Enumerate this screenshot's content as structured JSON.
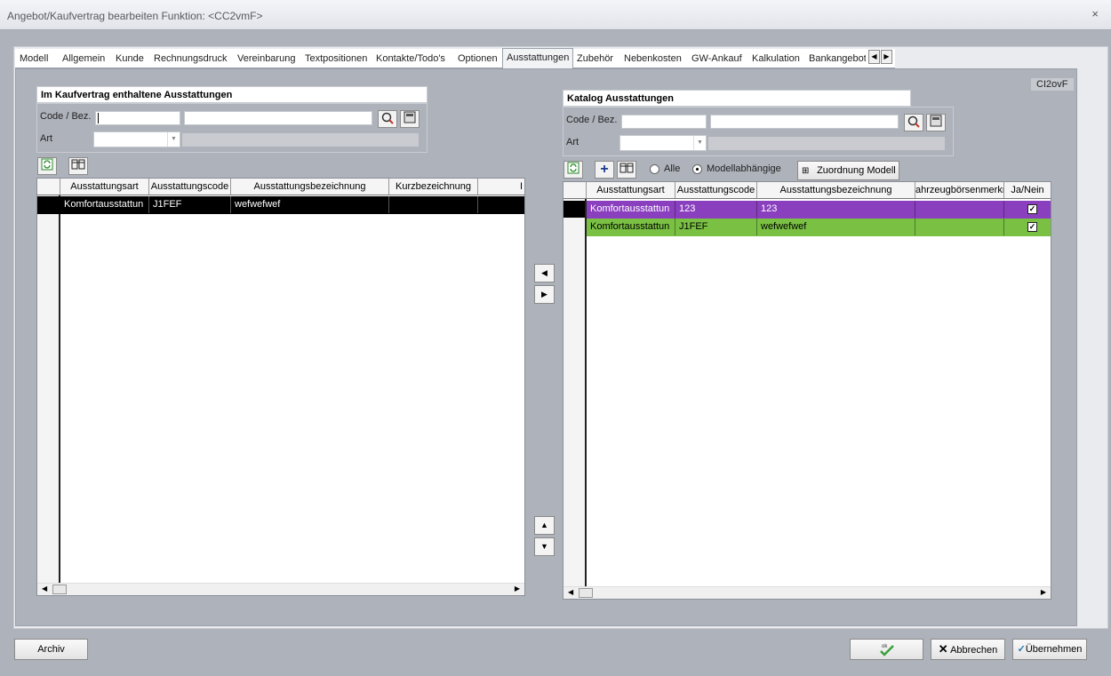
{
  "window": {
    "title": "Angebot/Kaufvertrag bearbeiten    Funktion: <CC2vmF>",
    "close_glyph": "×"
  },
  "tabs": [
    "Modell",
    "Allgemein",
    "Kunde",
    "Rechnungsdruck",
    "Vereinbarung",
    "Textpositionen",
    "Kontakte/Todo's",
    "Optionen",
    "Ausstattungen",
    "Zubehör",
    "Nebenkosten",
    "GW-Ankauf",
    "Kalkulation",
    "Bankangebot"
  ],
  "active_tab": "Ausstattungen",
  "corner_label": "CI2ovF",
  "left_panel": {
    "title": "Im Kaufvertrag enthaltene Ausstattungen",
    "code_label": "Code / Bez.",
    "art_label": "Art",
    "code_value": "",
    "bez_value": "",
    "art_value": "",
    "columns": [
      "Ausstattungsart",
      "Ausstattungscode",
      "Ausstattungsbezeichnung",
      "Kurzbezeichnung",
      "I"
    ],
    "rows": [
      {
        "art": "Komfortausstattun",
        "code": "J1FEF",
        "bez": "wefwefwef",
        "kurz": "",
        "extra": ""
      }
    ]
  },
  "right_panel": {
    "title": "Katalog Ausstattungen",
    "code_label": "Code / Bez.",
    "art_label": "Art",
    "radio_all": "Alle",
    "radio_model": "Modellabhängige",
    "assign_button": "Zuordnung Modell",
    "columns": [
      "Ausstattungsart",
      "Ausstattungscode",
      "Ausstattungsbezeichnung",
      "ahrzeugbörsenmerkm",
      "Ja/Nein"
    ],
    "rows": [
      {
        "art": "Komfortausstattun",
        "code": "123",
        "bez": "123",
        "boerse": "",
        "checked": true,
        "color": "#8a3fbf"
      },
      {
        "art": "Komfortausstattun",
        "code": "J1FEF",
        "bez": "wefwefwef",
        "boerse": "",
        "checked": true,
        "color": "#7ac143"
      }
    ]
  },
  "buttons": {
    "archive": "Archiv",
    "ok_icon": "ok",
    "cancel": "Abbrechen",
    "apply": "Übernehmen"
  },
  "colors": {
    "row_selected": "#000000",
    "row_purple": "#8a3fbf",
    "row_green": "#7ac143"
  }
}
